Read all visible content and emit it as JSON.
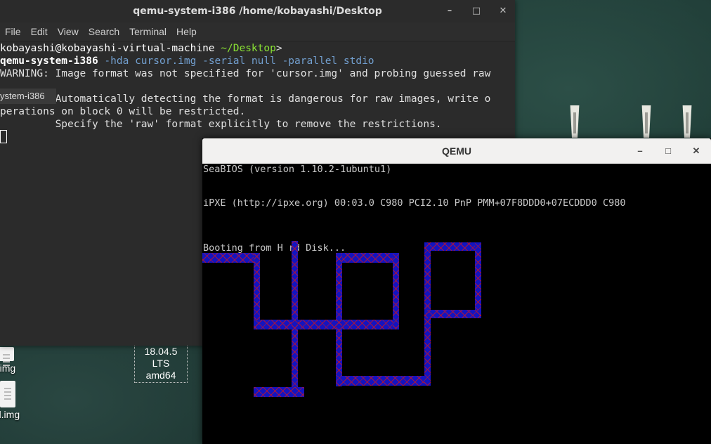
{
  "terminal": {
    "title": "qemu-system-i386  /home/kobayashi/Desktop",
    "menu": [
      "File",
      "Edit",
      "View",
      "Search",
      "Terminal",
      "Help"
    ],
    "prompt_user": "kobayashi@kobayashi-virtual-machine",
    "prompt_path": " ~/Desktop",
    "prompt_symbol": ">",
    "command": "qemu-system-i386",
    "command_args": " -hda cursor.img -serial null -parallel stdio",
    "warning_line1": "WARNING: Image format was not specified for 'cursor.img' and probing guessed raw",
    "warning_line2": "         Automatically detecting the format is dangerous for raw images, write o",
    "warning_line3": "perations on block 0 will be restricted.",
    "warning_line4": "         Specify the 'raw' format explicitly to remove the restrictions.",
    "tooltip": "ystem-i386"
  },
  "qemu": {
    "title": "QEMU",
    "lines": [
      "SeaBIOS (version 1.10.2-1ubuntu1)",
      "iPXE (http://ipxe.org) 00:03.0 C980 PCI2.10 PnP PMM+07F8DDD0+07ECDDD0 C980",
      "Booting from H",
      "rd Disk..."
    ]
  },
  "desktop": {
    "icon1_label": ".img",
    "icon2_label": "d.img",
    "iso_label_line1": "18.04.5 LTS",
    "iso_label_line2": "amd64"
  },
  "wm": {
    "minimize": "–",
    "maximize": "□",
    "close": "✕"
  },
  "colors": {
    "block_fill": "#1414c0",
    "block_mark": "#c0142a",
    "prompt_path": "#8ae234",
    "args": "#729fcf"
  }
}
